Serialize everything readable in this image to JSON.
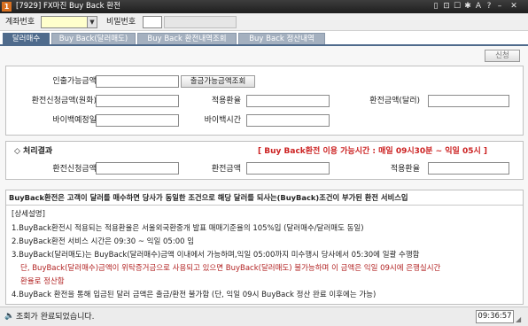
{
  "window": {
    "badge": "1",
    "title": "[7929] FX마진 Buy Back 환전",
    "controls": [
      "▯",
      "⊡",
      "☐",
      "✱",
      "A",
      "?",
      "–",
      "✕"
    ]
  },
  "account": {
    "account_label": "계좌번호",
    "account_value": "",
    "password_label": "비밀번호",
    "password_value": ""
  },
  "tabs": [
    {
      "label": "달러매수",
      "active": true
    },
    {
      "label": "Buy Back(달러매도)",
      "active": false
    },
    {
      "label": "Buy Back 환전내역조회",
      "active": false
    },
    {
      "label": "Buy Back 정산내역",
      "active": false
    }
  ],
  "toolbar": {
    "apply_label": "신청"
  },
  "form": {
    "withdraw_label": "인출가능금액",
    "withdraw_value": "",
    "withdraw_query_button": "출금가능금액조회",
    "request_krw_label": "환전신청금액(원화)",
    "request_krw_value": "",
    "rate_label": "적용환율",
    "rate_value": "",
    "usd_label": "환전금액(달러)",
    "usd_value": "",
    "bb_date_label": "바이백예정일",
    "bb_date_value": "",
    "bb_time_label": "바이백시간",
    "bb_time_value": ""
  },
  "result": {
    "title": "◇ 처리결과",
    "hours": "[ Buy Back환전 이용 가능시간 : 매일 09시30분 ~ 익일 05시 ]",
    "req_label": "환전신청금액",
    "req_value": "",
    "amt_label": "환전금액",
    "amt_value": "",
    "rate_label": "적용환율",
    "rate_value": ""
  },
  "notice": {
    "headline": "BuyBack환전은 고객이 달러를 매수하면 당사가 동일한 조건으로 해당 달러를 되사는(BuyBack)조건이 부가된 환전 서비스입",
    "section": "[상세설명]",
    "lines": [
      "1.BuyBack환전시 적용되는 적용환율은 서울외국환중개 발표 매매기준율의 105%입 (달러매수/달러매도 동일)",
      "2.BuyBack환전 서비스 시간은 09:30 ~ 익일 05:00 임",
      "3.BuyBack(달러매도)는 BuyBack(달러매수)금액 이내에서 가능하며,익일 05:00까지 미수행시 당사에서 05:30에 일괄 수행함",
      "단, BuyBack(달러매수)금액이 위탁증거금으로 사용되고 있으면 BuyBack(달러매도) 불가능하며 이 금액은 익일 09시에 은행실시간",
      "환율로 정산함",
      "4.BuyBack 환전을 통해 입금된 달러 금액은 출금/환전 불가함 (단, 익일 09시 BuyBack 정산 완료 이후에는 가능)"
    ]
  },
  "status": {
    "message": "조회가 완료되었습니다.",
    "time": "09:36:57"
  },
  "colors": {
    "accent": "#4f6b8c",
    "warning_text": "#cc2222",
    "account_field_bg": "#ffffcc"
  }
}
